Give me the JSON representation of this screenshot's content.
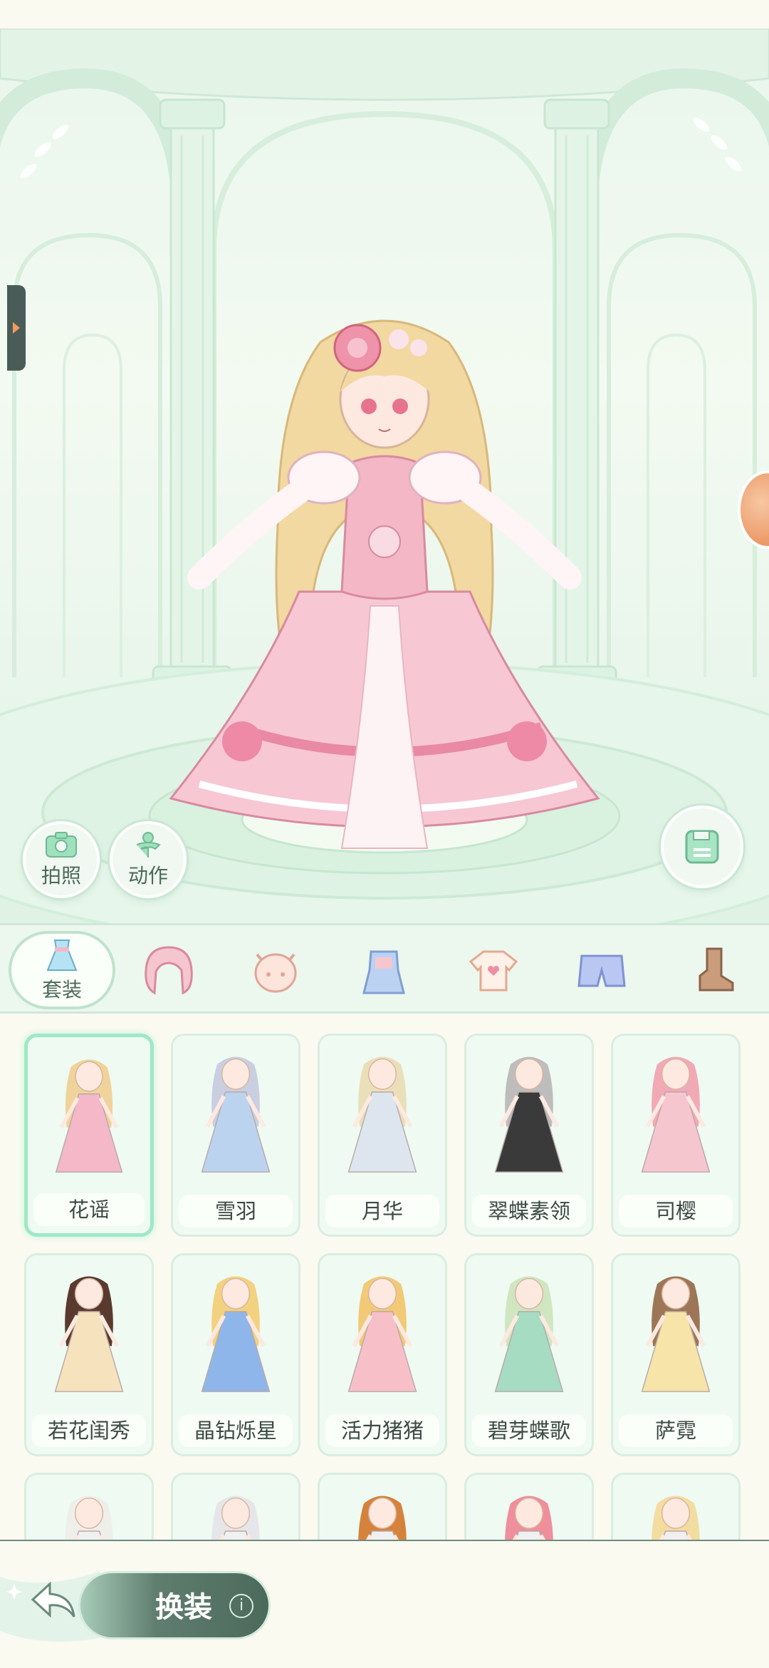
{
  "stage": {
    "photo_label": "拍照",
    "action_label": "动作"
  },
  "categories": [
    {
      "label": "套装",
      "icon": "dress-set-icon",
      "active": true
    },
    {
      "label": "",
      "icon": "hair-icon"
    },
    {
      "label": "",
      "icon": "face-icon"
    },
    {
      "label": "",
      "icon": "overalls-icon"
    },
    {
      "label": "",
      "icon": "top-shirt-icon"
    },
    {
      "label": "",
      "icon": "shorts-icon"
    },
    {
      "label": "",
      "icon": "boots-icon"
    }
  ],
  "outfits": [
    {
      "name": "花谣",
      "selected": true,
      "dress": "#f4b8c8",
      "hair": "#f0d39a"
    },
    {
      "name": "雪羽",
      "dress": "#bcd3ef",
      "hair": "#c9cfe0"
    },
    {
      "name": "月华",
      "dress": "#dde6ef",
      "hair": "#eadfb8"
    },
    {
      "name": "翠蝶素领",
      "dress": "#3a3a3a",
      "hair": "#bdbdbd"
    },
    {
      "name": "司樱",
      "dress": "#f6c6cf",
      "hair": "#f2a9b6"
    },
    {
      "name": "若花闺秀",
      "dress": "#f6e2bd",
      "hair": "#5a3a2f"
    },
    {
      "name": "晶钻烁星",
      "dress": "#8fb6ea",
      "hair": "#f2d27e"
    },
    {
      "name": "活力猪猪",
      "dress": "#f7c0c8",
      "hair": "#f2c977"
    },
    {
      "name": "碧芽蝶歌",
      "dress": "#a6dcc2",
      "hair": "#cfe6c0"
    },
    {
      "name": "萨霓",
      "dress": "#f6e4a8",
      "hair": "#9c7656"
    }
  ],
  "partial_outfits": [
    {
      "hair": "#eeeeea"
    },
    {
      "hair": "#e6e6ea"
    },
    {
      "hair": "#d5823c"
    },
    {
      "hair": "#ef8f9c"
    },
    {
      "hair": "#f3dca0"
    }
  ],
  "bottom": {
    "dress_up_label": "换装",
    "info": "i"
  },
  "colors": {
    "accent_green": "#9fe8c6",
    "text_dark": "#3b4a44",
    "button_dark": "#4b6a5c"
  }
}
